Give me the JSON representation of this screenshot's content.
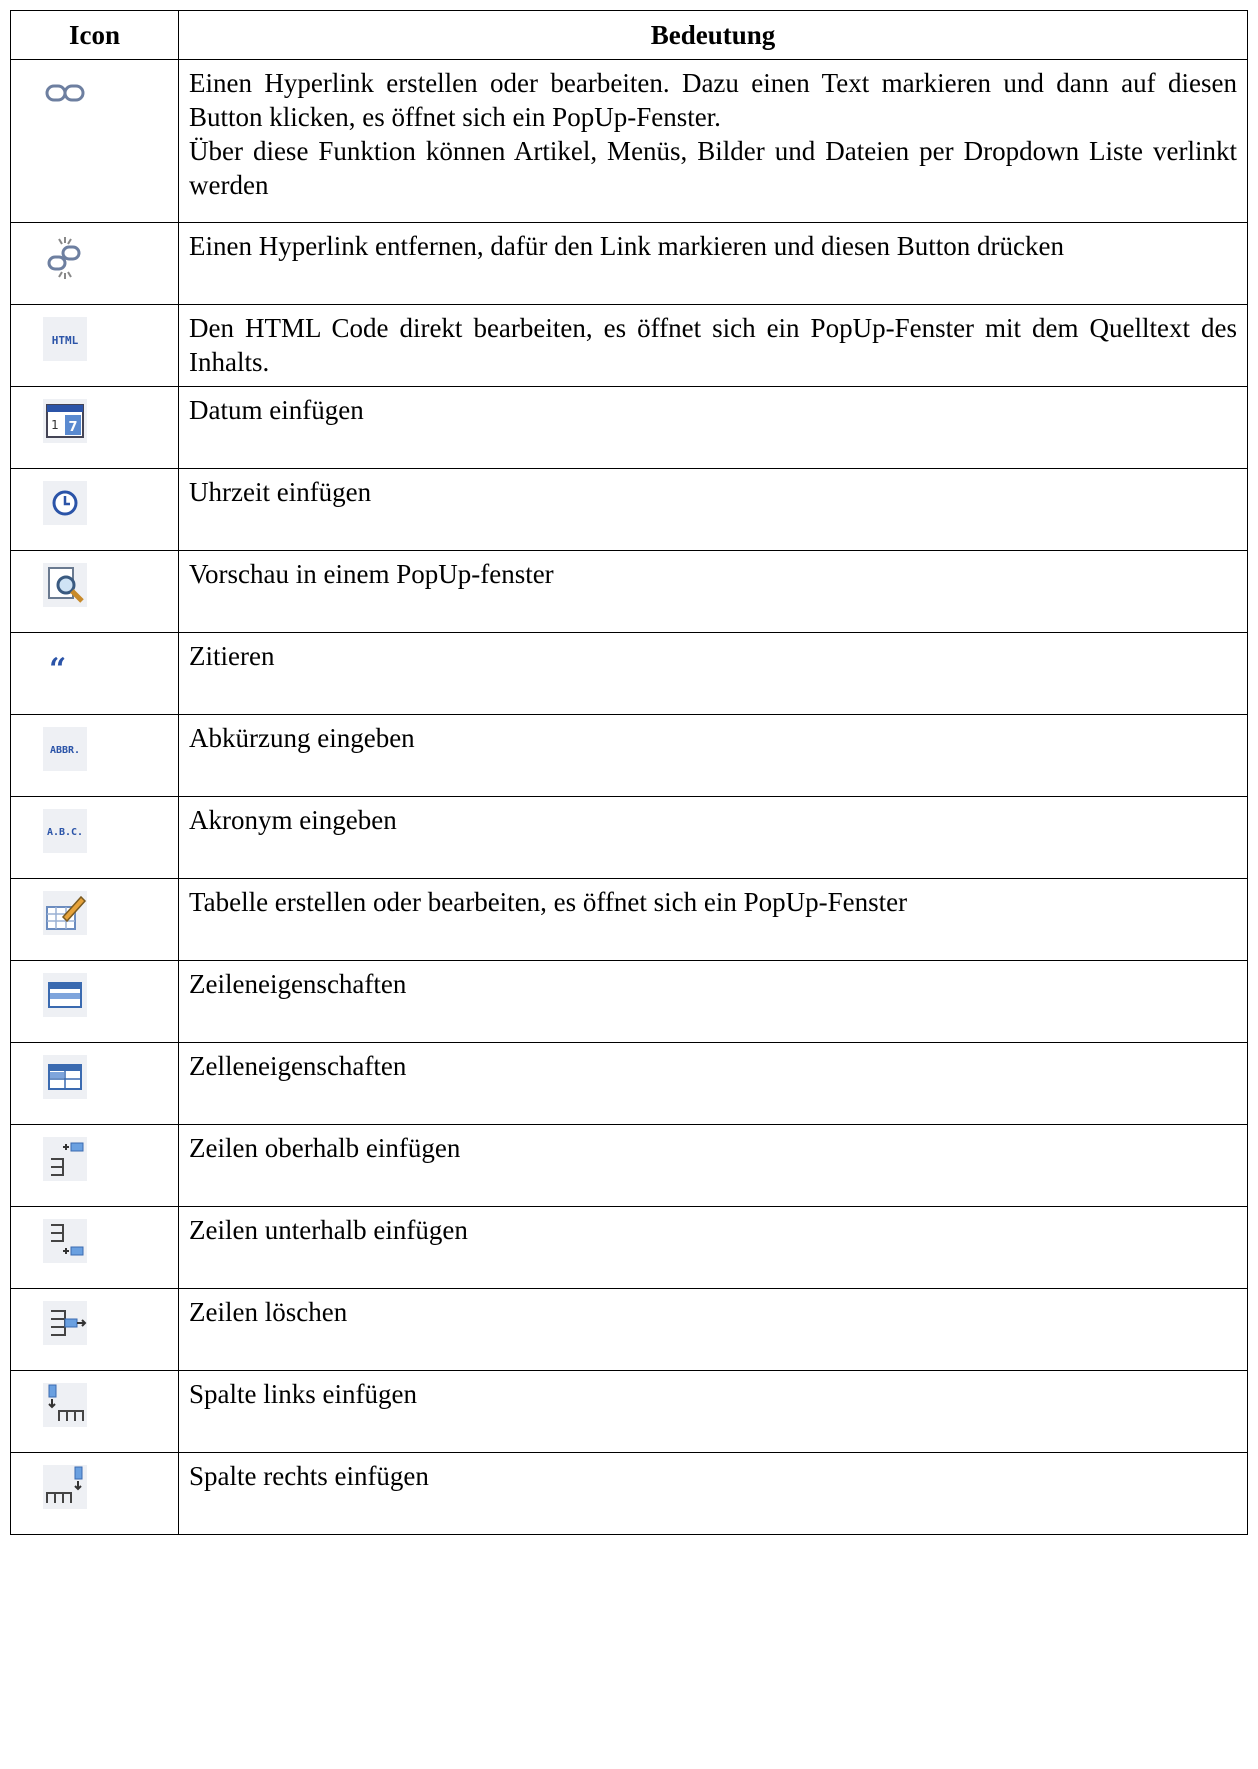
{
  "header": {
    "icon": "Icon",
    "meaning": "Bedeutung"
  },
  "rows": [
    {
      "icon": "link-icon",
      "lines": [
        "Einen Hyperlink erstellen oder bearbeiten. Dazu einen Text markieren und dann auf diesen Button klicken, es öffnet sich ein PopUp-Fenster.",
        "Über diese Funktion können Artikel, Menüs, Bilder und Dateien per Dropdown Liste verlinkt werden"
      ]
    },
    {
      "icon": "unlink-icon",
      "lines": [
        "Einen Hyperlink entfernen, dafür den Link markieren und diesen Button drücken"
      ]
    },
    {
      "icon": "html-code-icon",
      "icon_text": "HTML",
      "lines": [
        "Den HTML Code direkt bearbeiten, es öffnet sich ein PopUp-Fenster mit dem Quelltext des Inhalts."
      ]
    },
    {
      "icon": "calendar-icon",
      "lines": [
        "Datum einfügen"
      ]
    },
    {
      "icon": "clock-icon",
      "lines": [
        "Uhrzeit einfügen"
      ]
    },
    {
      "icon": "preview-icon",
      "lines": [
        "Vorschau in einem PopUp-fenster"
      ]
    },
    {
      "icon": "quote-icon",
      "icon_text": "66",
      "lines": [
        "Zitieren"
      ]
    },
    {
      "icon": "abbr-icon",
      "icon_text": "ABBR.",
      "lines": [
        "Abkürzung eingeben"
      ]
    },
    {
      "icon": "acronym-icon",
      "icon_text": "A.B.C.",
      "lines": [
        "Akronym eingeben"
      ]
    },
    {
      "icon": "table-edit-icon",
      "lines": [
        "Tabelle erstellen oder bearbeiten, es öffnet sich ein PopUp-Fenster"
      ]
    },
    {
      "icon": "row-properties-icon",
      "lines": [
        "Zeileneigenschaften"
      ]
    },
    {
      "icon": "cell-properties-icon",
      "lines": [
        "Zelleneigenschaften"
      ]
    },
    {
      "icon": "insert-row-above-icon",
      "lines": [
        "Zeilen oberhalb einfügen"
      ]
    },
    {
      "icon": "insert-row-below-icon",
      "lines": [
        "Zeilen unterhalb einfügen"
      ]
    },
    {
      "icon": "delete-row-icon",
      "lines": [
        "Zeilen löschen"
      ]
    },
    {
      "icon": "insert-col-left-icon",
      "lines": [
        "Spalte links einfügen"
      ]
    },
    {
      "icon": "insert-col-right-icon",
      "lines": [
        "Spalte rechts einfügen"
      ]
    }
  ],
  "colors": {
    "icon_blue": "#2b54a8",
    "icon_bg": "#eef0f4",
    "border": "#000000"
  }
}
